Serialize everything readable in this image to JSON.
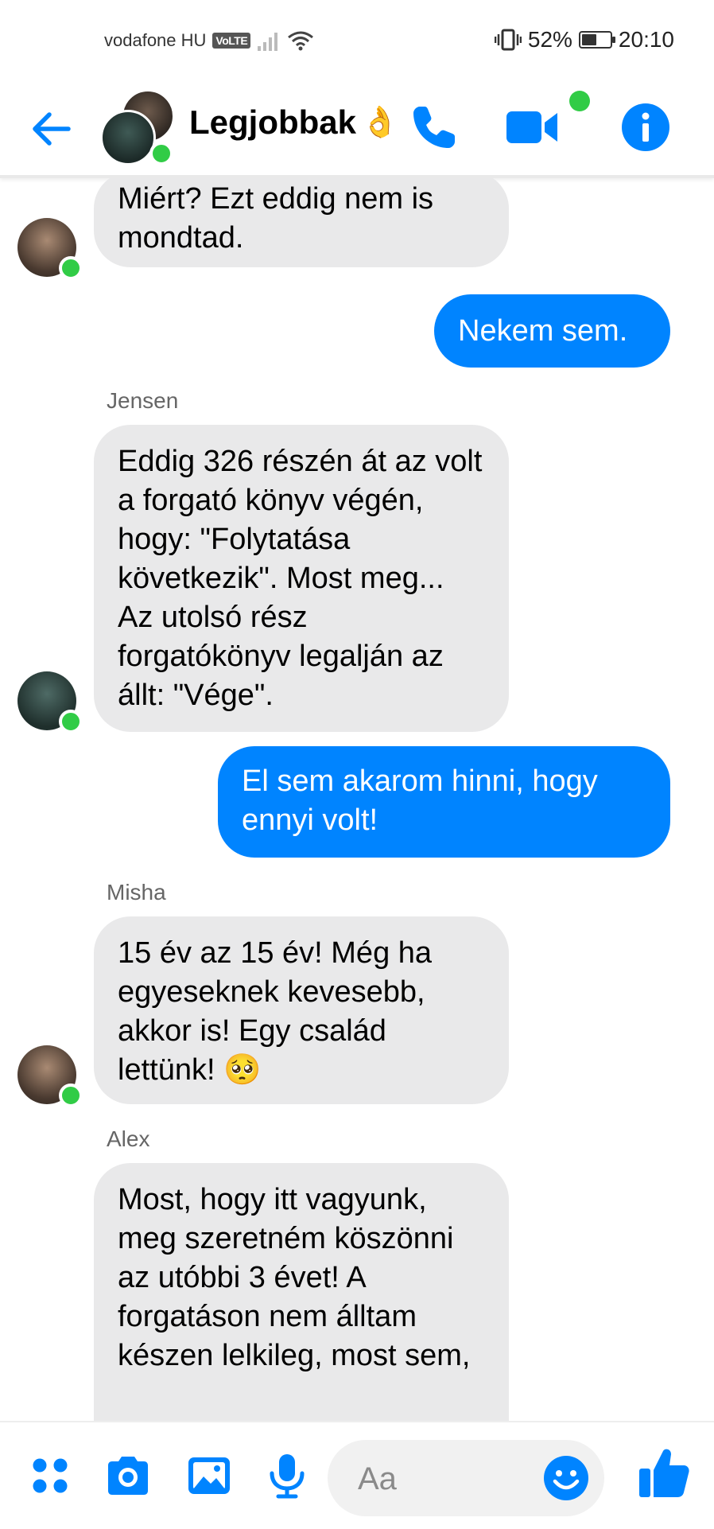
{
  "status_bar": {
    "carrier": "vodafone HU",
    "volte": "VoLTE",
    "battery_percent": "52%",
    "battery_level": 0.52,
    "time": "20:10"
  },
  "header": {
    "title": "Legjobbak",
    "title_emoji": "👌",
    "icons": [
      "back-arrow-icon",
      "phone-icon",
      "video-camera-icon",
      "info-icon"
    ],
    "accent_color": "#0084ff",
    "online_color": "#31cc46"
  },
  "messages": [
    {
      "direction": "incoming",
      "text": "Miért? Ezt eddig nem is mondtad."
    },
    {
      "direction": "outgoing",
      "text": "Nekem sem."
    },
    {
      "direction": "incoming",
      "sender": "Jensen",
      "text": "Eddig 326 részén át az volt a forgató könyv végén, hogy: \"Folytatása következik\". Most meg... Az utolsó rész forgatókönyv legalján az állt: \"Vége\"."
    },
    {
      "direction": "outgoing",
      "text": "El sem akarom hinni, hogy ennyi volt!"
    },
    {
      "direction": "incoming",
      "sender": "Misha",
      "text": "15 év az 15 év! Még ha egyeseknek kevesebb, akkor is! Egy család lettünk! 🥺"
    },
    {
      "direction": "incoming",
      "sender": "Alex",
      "text": "Most, hogy itt vagyunk, meg szeretném köszönni az utóbbi 3 évet! A forgatáson nem álltam készen lelkileg, most sem,"
    }
  ],
  "composer": {
    "placeholder": "Aa",
    "icons": [
      "apps-grid-icon",
      "camera-icon",
      "image-icon",
      "microphone-icon",
      "emoji-icon",
      "thumbs-up-icon"
    ]
  }
}
